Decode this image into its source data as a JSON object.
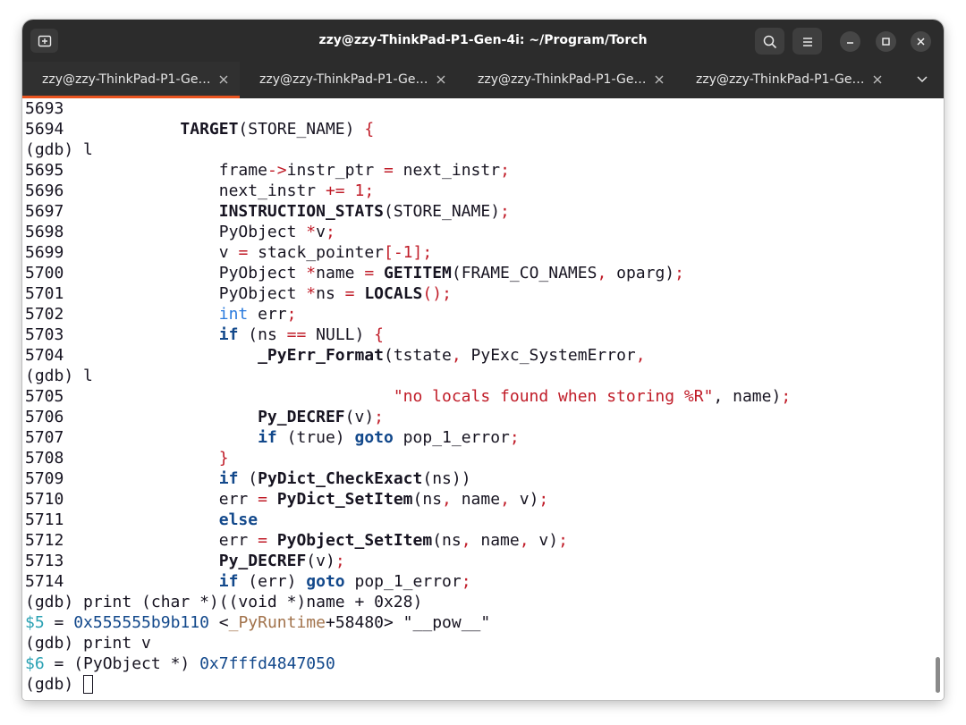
{
  "window": {
    "title": "zzy@zzy-ThinkPad-P1-Gen-4i: ~/Program/Torch"
  },
  "tabs": [
    {
      "label": "zzy@zzy-ThinkPad-P1-Ge…",
      "active": true
    },
    {
      "label": "zzy@zzy-ThinkPad-P1-Ge…",
      "active": false
    },
    {
      "label": "zzy@zzy-ThinkPad-P1-Ge…",
      "active": false
    },
    {
      "label": "zzy@zzy-ThinkPad-P1-Ge…",
      "active": false
    }
  ],
  "icons": {
    "new_tab": "new-tab-icon",
    "search": "search-icon",
    "menu": "hamburger-menu-icon",
    "minimize": "minimize-icon",
    "maximize": "maximize-icon",
    "close": "close-icon",
    "tab_close": "close-icon",
    "tab_list": "chevron-down-icon"
  },
  "colors": {
    "titlebar_bg": "#2c2c2c",
    "terminal_bg": "#ffffff",
    "terminal_fg": "#171421",
    "keyword_red": "#c01c28",
    "keyword_blue": "#12488b",
    "type_blue": "#2a7bde",
    "var_cyan": "#2aa1b3",
    "symbol_brown": "#a2734c",
    "active_tab_accent": "#e95420"
  },
  "terminal": {
    "lines": [
      [
        {
          "t": "5693"
        }
      ],
      [
        {
          "t": "5694            "
        },
        {
          "t": "TARGET",
          "s": "f"
        },
        {
          "t": "(STORE_NAME) "
        },
        {
          "t": "{",
          "s": "k"
        }
      ],
      [
        {
          "t": "(gdb) l"
        }
      ],
      [
        {
          "t": "5695                "
        },
        {
          "t": "frame"
        },
        {
          "t": "->",
          "s": "k"
        },
        {
          "t": "instr_ptr "
        },
        {
          "t": "=",
          "s": "k"
        },
        {
          "t": " next_instr"
        },
        {
          "t": ";",
          "s": "k"
        }
      ],
      [
        {
          "t": "5696                "
        },
        {
          "t": "next_instr "
        },
        {
          "t": "+=",
          "s": "k"
        },
        {
          "t": " "
        },
        {
          "t": "1",
          "s": "k"
        },
        {
          "t": ";",
          "s": "k"
        }
      ],
      [
        {
          "t": "5697                "
        },
        {
          "t": "INSTRUCTION_STATS",
          "s": "f"
        },
        {
          "t": "(STORE_NAME)"
        },
        {
          "t": ";",
          "s": "k"
        }
      ],
      [
        {
          "t": "5698                "
        },
        {
          "t": "PyObject "
        },
        {
          "t": "*",
          "s": "k"
        },
        {
          "t": "v"
        },
        {
          "t": ";",
          "s": "k"
        }
      ],
      [
        {
          "t": "5699                "
        },
        {
          "t": "v "
        },
        {
          "t": "=",
          "s": "k"
        },
        {
          "t": " stack_pointer"
        },
        {
          "t": "[-1]",
          "s": "k"
        },
        {
          "t": ";",
          "s": "k"
        }
      ],
      [
        {
          "t": "5700                "
        },
        {
          "t": "PyObject "
        },
        {
          "t": "*",
          "s": "k"
        },
        {
          "t": "name "
        },
        {
          "t": "=",
          "s": "k"
        },
        {
          "t": " "
        },
        {
          "t": "GETITEM",
          "s": "f"
        },
        {
          "t": "(FRAME_CO_NAMES"
        },
        {
          "t": ",",
          "s": "k"
        },
        {
          "t": " oparg)"
        },
        {
          "t": ";",
          "s": "k"
        }
      ],
      [
        {
          "t": "5701                "
        },
        {
          "t": "PyObject "
        },
        {
          "t": "*",
          "s": "k"
        },
        {
          "t": "ns "
        },
        {
          "t": "=",
          "s": "k"
        },
        {
          "t": " "
        },
        {
          "t": "LOCALS",
          "s": "f"
        },
        {
          "t": "()",
          "s": "k"
        },
        {
          "t": ";",
          "s": "k"
        }
      ],
      [
        {
          "t": "5702                "
        },
        {
          "t": "int",
          "s": "t"
        },
        {
          "t": " err"
        },
        {
          "t": ";",
          "s": "k"
        }
      ],
      [
        {
          "t": "5703                "
        },
        {
          "t": "if",
          "s": "b"
        },
        {
          "t": " (ns "
        },
        {
          "t": "==",
          "s": "k"
        },
        {
          "t": " NULL) "
        },
        {
          "t": "{",
          "s": "k"
        }
      ],
      [
        {
          "t": "5704                    "
        },
        {
          "t": "_PyErr_Format",
          "s": "f"
        },
        {
          "t": "(tstate"
        },
        {
          "t": ",",
          "s": "k"
        },
        {
          "t": " PyExc_SystemError"
        },
        {
          "t": ",",
          "s": "k"
        }
      ],
      [
        {
          "t": "(gdb) l"
        }
      ],
      [
        {
          "t": "5705                                  "
        },
        {
          "t": "\"no locals found when storing %R\"",
          "s": "k"
        },
        {
          "t": ","
        },
        {
          "t": " name)"
        },
        {
          "t": ";",
          "s": "k"
        }
      ],
      [
        {
          "t": "5706                    "
        },
        {
          "t": "Py_DECREF",
          "s": "f"
        },
        {
          "t": "(v)"
        },
        {
          "t": ";",
          "s": "k"
        }
      ],
      [
        {
          "t": "5707                    "
        },
        {
          "t": "if",
          "s": "b"
        },
        {
          "t": " (true) "
        },
        {
          "t": "goto",
          "s": "b"
        },
        {
          "t": " pop_1_error"
        },
        {
          "t": ";",
          "s": "k"
        }
      ],
      [
        {
          "t": "5708                "
        },
        {
          "t": "}",
          "s": "k"
        }
      ],
      [
        {
          "t": "5709                "
        },
        {
          "t": "if",
          "s": "b"
        },
        {
          "t": " ("
        },
        {
          "t": "PyDict_CheckExact",
          "s": "f"
        },
        {
          "t": "(ns))"
        }
      ],
      [
        {
          "t": "5710                "
        },
        {
          "t": "err "
        },
        {
          "t": "=",
          "s": "k"
        },
        {
          "t": " "
        },
        {
          "t": "PyDict_SetItem",
          "s": "f"
        },
        {
          "t": "(ns"
        },
        {
          "t": ",",
          "s": "k"
        },
        {
          "t": " name"
        },
        {
          "t": ",",
          "s": "k"
        },
        {
          "t": " v)"
        },
        {
          "t": ";",
          "s": "k"
        }
      ],
      [
        {
          "t": "5711                "
        },
        {
          "t": "else",
          "s": "b"
        }
      ],
      [
        {
          "t": "5712                "
        },
        {
          "t": "err "
        },
        {
          "t": "=",
          "s": "k"
        },
        {
          "t": " "
        },
        {
          "t": "PyObject_SetItem",
          "s": "f"
        },
        {
          "t": "(ns"
        },
        {
          "t": ",",
          "s": "k"
        },
        {
          "t": " name"
        },
        {
          "t": ",",
          "s": "k"
        },
        {
          "t": " v)"
        },
        {
          "t": ";",
          "s": "k"
        }
      ],
      [
        {
          "t": "5713                "
        },
        {
          "t": "Py_DECREF",
          "s": "f"
        },
        {
          "t": "(v)"
        },
        {
          "t": ";",
          "s": "k"
        }
      ],
      [
        {
          "t": "5714                "
        },
        {
          "t": "if",
          "s": "b"
        },
        {
          "t": " (err) "
        },
        {
          "t": "goto",
          "s": "b"
        },
        {
          "t": " pop_1_error"
        },
        {
          "t": ";",
          "s": "k"
        }
      ],
      [
        {
          "t": "(gdb) print (char *)((void *)name + 0x28)"
        }
      ],
      [
        {
          "t": "$5",
          "s": "c"
        },
        {
          "t": " = "
        },
        {
          "t": "0x555555b9b110",
          "s": "b-nobold"
        },
        {
          "t": " <"
        },
        {
          "t": "_PyRuntime",
          "s": "m"
        },
        {
          "t": "+58480> \"__pow__\""
        }
      ],
      [
        {
          "t": "(gdb) print v"
        }
      ],
      [
        {
          "t": "$6",
          "s": "c"
        },
        {
          "t": " = (PyObject *) "
        },
        {
          "t": "0x7fffd4847050",
          "s": "b-nobold"
        }
      ],
      [
        {
          "t": "(gdb) "
        },
        {
          "t": "",
          "s": "cursor"
        }
      ]
    ]
  }
}
